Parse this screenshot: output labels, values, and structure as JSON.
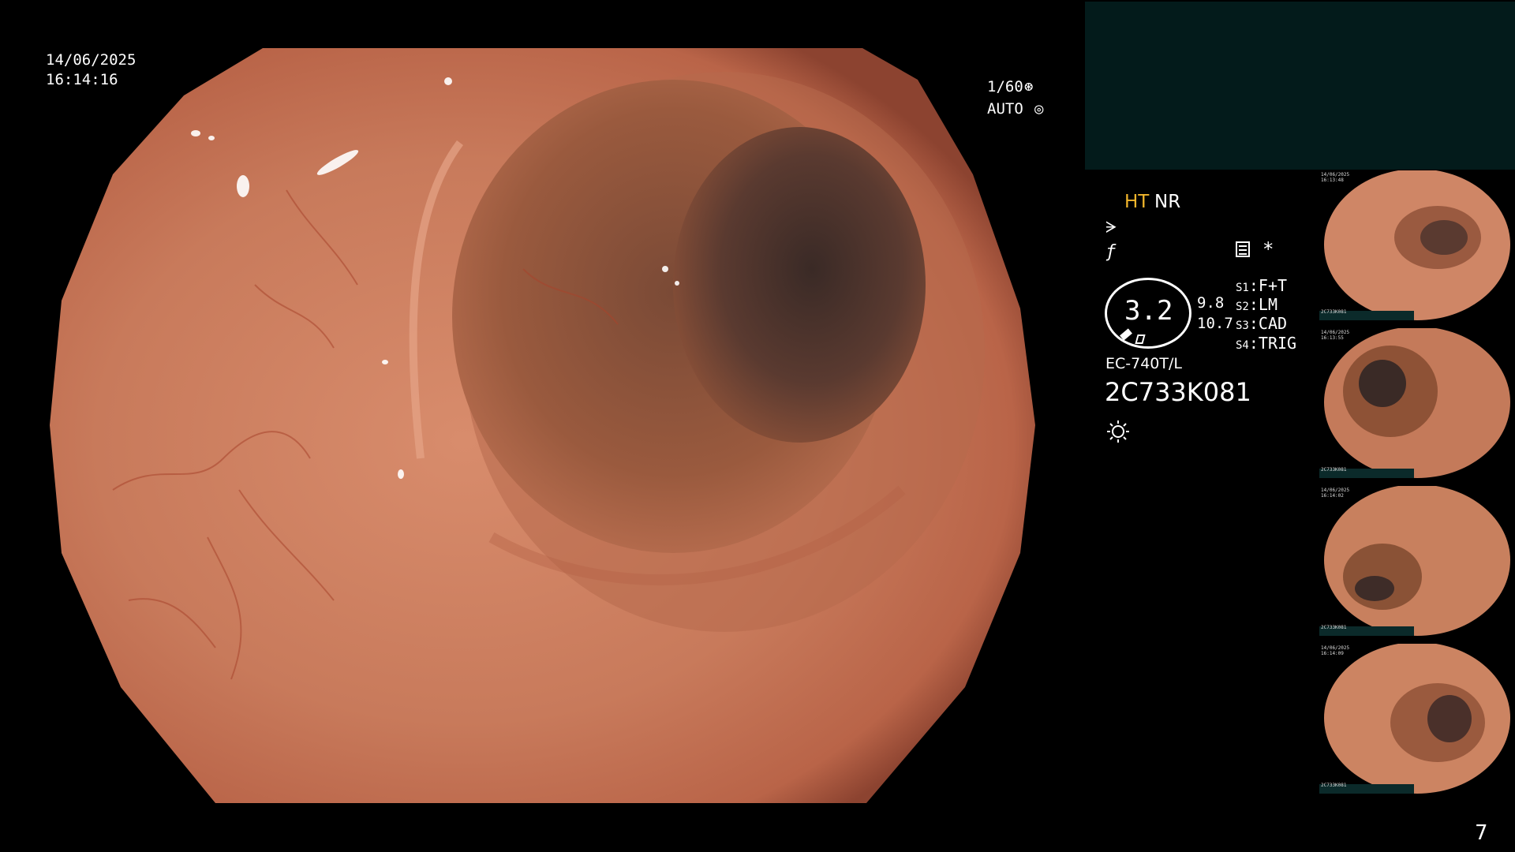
{
  "overlay": {
    "date": "14/06/2025",
    "time": "16:14:16",
    "shutter": "1/60",
    "shutter_icon": "aperture-icon",
    "exposure": "AUTO",
    "exposure_icon": "iris-icon"
  },
  "settings": {
    "ht_label": "HT",
    "nr_label": "NR",
    "enhancement_icon": "enhancement-icon",
    "f_icon": "f-symbol-icon",
    "doc_icon": "document-icon",
    "star_icon": "asterisk-icon",
    "zoom_value": "3.2",
    "value_a": "9.8",
    "value_b": "10.7",
    "slots": [
      {
        "key": "S1",
        "value": "F+T"
      },
      {
        "key": "S2",
        "value": "LM"
      },
      {
        "key": "S3",
        "value": "CAD"
      },
      {
        "key": "S4",
        "value": "TRIG"
      }
    ],
    "scope_model": "EC-740T/L",
    "scope_serial": "2C733K081",
    "light_icon": "light-source-icon"
  },
  "colors": {
    "highlight": "#f2b62c",
    "teal_panel": "#031b1b",
    "mucosa": "#c8795a"
  },
  "thumbnails": [
    {
      "id": "thumb-1",
      "lines": [
        "14/06/2025",
        "16:13:48",
        "",
        "",
        "",
        "",
        "",
        "",
        "",
        "",
        "2C733K081"
      ]
    },
    {
      "id": "thumb-2",
      "lines": [
        "14/06/2025",
        "16:13:55",
        "",
        "",
        "",
        "",
        "",
        "",
        "",
        "",
        "2C733K081"
      ]
    },
    {
      "id": "thumb-3",
      "lines": [
        "14/06/2025",
        "16:14:02",
        "",
        "",
        "",
        "",
        "",
        "",
        "",
        "",
        "2C733K081"
      ]
    },
    {
      "id": "thumb-4",
      "lines": [
        "14/06/2025",
        "16:14:09",
        "",
        "",
        "",
        "",
        "",
        "",
        "",
        "",
        "2C733K081"
      ]
    }
  ],
  "page_number": "7"
}
